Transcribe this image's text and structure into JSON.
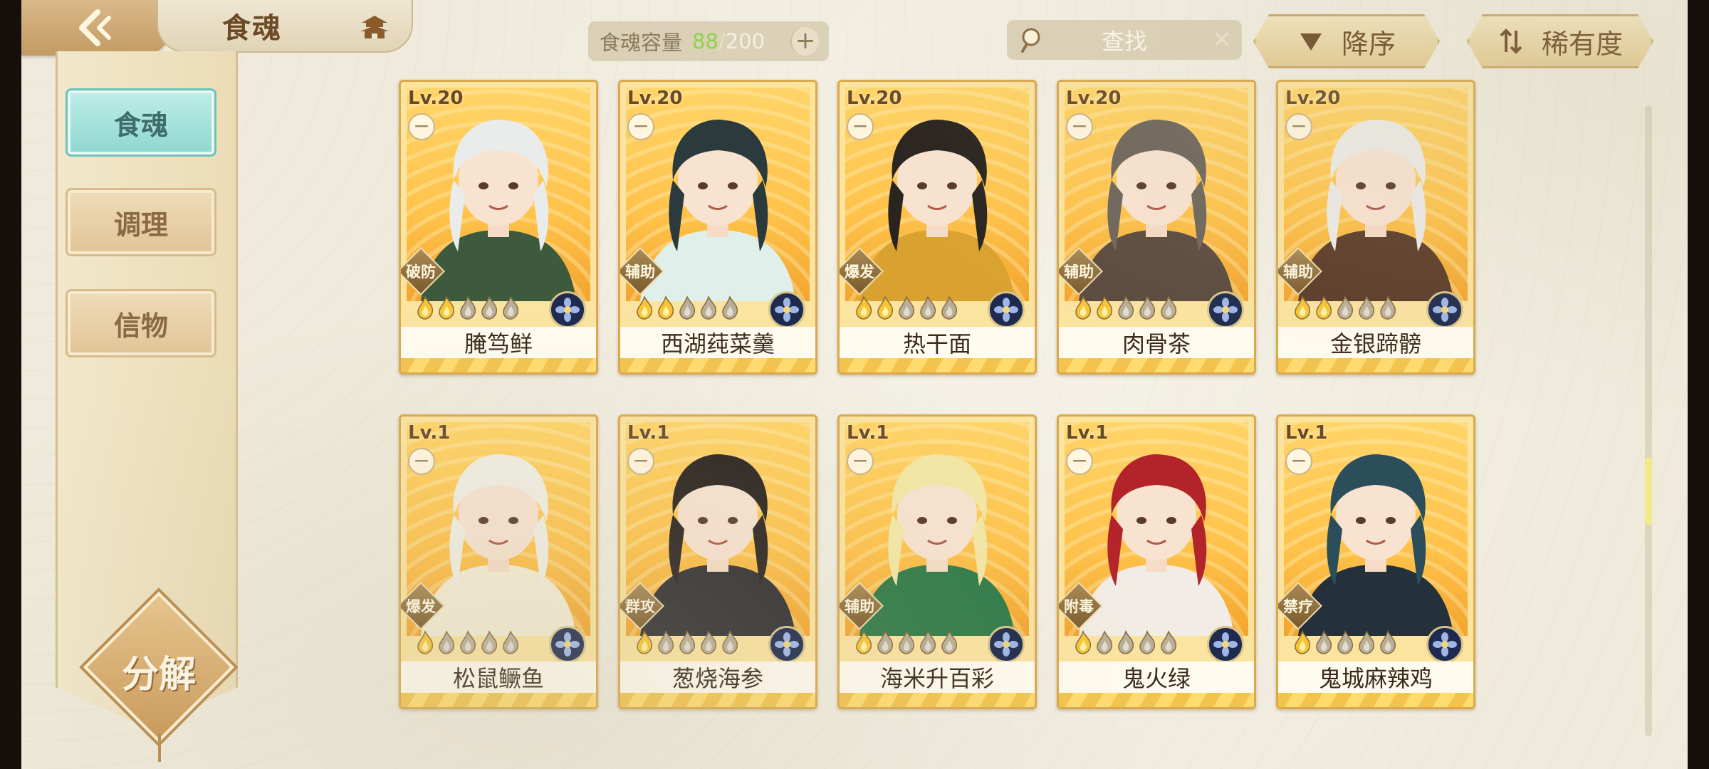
{
  "header": {
    "title": "食魂",
    "capacity_label": "食魂容量",
    "capacity_current": "88",
    "capacity_separator": "/",
    "capacity_max": "200",
    "search_placeholder": "查找",
    "sort_order_label": "降序",
    "sort_key_label": "稀有度"
  },
  "sidebar": {
    "items": [
      {
        "label": "食魂",
        "active": true
      },
      {
        "label": "调理",
        "active": false
      },
      {
        "label": "信物",
        "active": false
      }
    ],
    "decompose_label": "分解"
  },
  "cards": [
    {
      "level": "Lv.20",
      "role": "破防",
      "name": "腌笃鲜",
      "stars_filled": 2,
      "stars_total": 5,
      "hair": "#e9ecea",
      "outfit": "#3e5a3c"
    },
    {
      "level": "Lv.20",
      "role": "辅助",
      "name": "西湖莼菜羹",
      "stars_filled": 2,
      "stars_total": 5,
      "hair": "#2b3a3c",
      "outfit": "#dfefea"
    },
    {
      "level": "Lv.20",
      "role": "爆发",
      "name": "热干面",
      "stars_filled": 2,
      "stars_total": 5,
      "hair": "#2a2420",
      "outfit": "#d9a230"
    },
    {
      "level": "Lv.20",
      "role": "辅助",
      "name": "肉骨茶",
      "stars_filled": 2,
      "stars_total": 5,
      "hair": "#6d655a",
      "outfit": "#5b4a3e"
    },
    {
      "level": "Lv.20",
      "role": "辅助",
      "name": "金银蹄髈",
      "stars_filled": 2,
      "stars_total": 5,
      "hair": "#ecebe6",
      "outfit": "#5a3a28"
    },
    {
      "level": "Lv.1",
      "role": "爆发",
      "name": "松鼠鳜鱼",
      "stars_filled": 1,
      "stars_total": 5,
      "hair": "#f1efe4",
      "outfit": "#f3ecd4"
    },
    {
      "level": "Lv.1",
      "role": "群攻",
      "name": "葱烧海参",
      "stars_filled": 1,
      "stars_total": 5,
      "hair": "#2b2420",
      "outfit": "#2f2f32"
    },
    {
      "level": "Lv.1",
      "role": "辅助",
      "name": "海米升百彩",
      "stars_filled": 1,
      "stars_total": 5,
      "hair": "#f3e7a6",
      "outfit": "#2f7a48"
    },
    {
      "level": "Lv.1",
      "role": "附毒",
      "name": "鬼火绿",
      "stars_filled": 1,
      "stars_total": 5,
      "hair": "#b3242a",
      "outfit": "#f2ece6"
    },
    {
      "level": "Lv.1",
      "role": "禁疗",
      "name": "鬼城麻辣鸡",
      "stars_filled": 1,
      "stars_total": 5,
      "hair": "#2c4e5a",
      "outfit": "#24303a"
    }
  ],
  "icons": {
    "back": "back-arrow-icon",
    "home": "pagoda-icon",
    "add": "plus-icon",
    "search": "magnifier-icon",
    "clear": "close-icon",
    "sort_order": "triangle-down-icon",
    "sort_key": "swap-icon",
    "element": "flower-icon",
    "star": "flame-star-icon"
  },
  "colors": {
    "accent_teal": "#8fd6d0",
    "card_gold": "#ffc24a",
    "capacity_green": "#8fd14f"
  }
}
